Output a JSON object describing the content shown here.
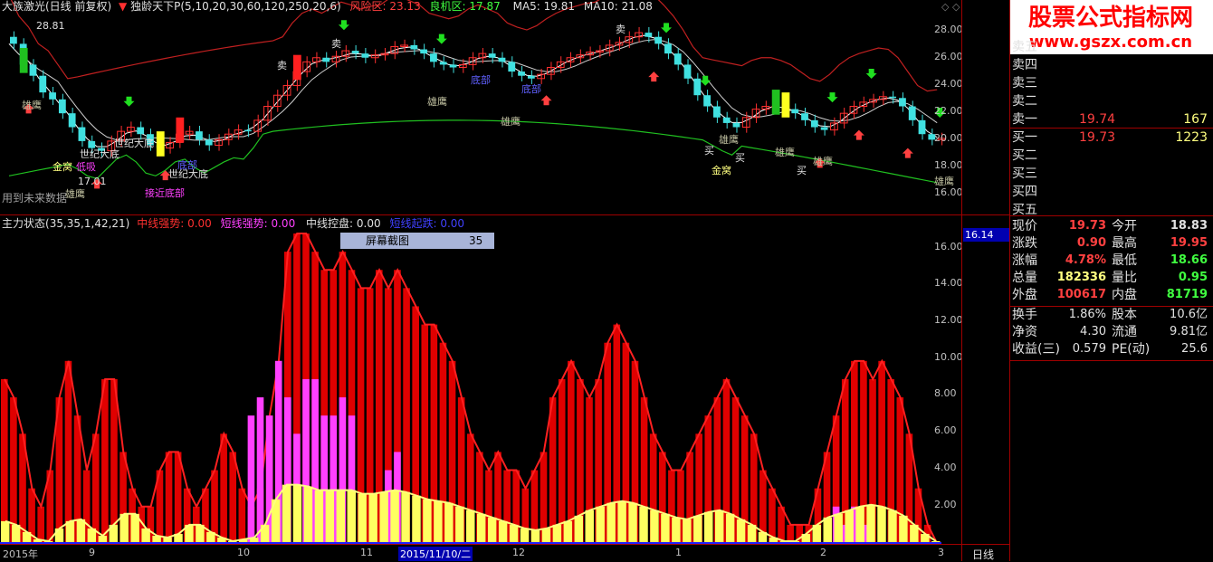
{
  "header": {
    "stock_title": "大族激光(日线 前复权)",
    "indicator_name": "独龄天下P",
    "indicator_params": "(5,10,20,30,60,120,250,20,6)",
    "risk_label": "风险区:",
    "risk_value": "23.13",
    "good_label": "良机区:",
    "good_value": "17.87",
    "ma5_label": "MA5:",
    "ma5_value": "19.81",
    "ma10_label": "MA10:",
    "ma10_value": "21.08",
    "high_marker": "28.81",
    "low_marker": "17.01",
    "future_note": "用到未来数据"
  },
  "lower_header": {
    "name": "主力状态",
    "params": "(35,35,1,42,21)",
    "mid_strong_label": "中线强势:",
    "mid_strong_value": "0.00",
    "short_strong_label": "短线强势:",
    "short_strong_value": "0.00",
    "mid_control_label": "中线控盘:",
    "mid_control_value": "0.00",
    "short_start_label": "短线起跌:",
    "short_start_value": "0.00"
  },
  "tooltip": {
    "label": "屏幕截图",
    "value": "35"
  },
  "upper_axis": [
    "28.00",
    "26.00",
    "24.00",
    "22.00",
    "20.00",
    "18.00",
    "16.00"
  ],
  "lower_axis": [
    "16.00",
    "14.00",
    "12.00",
    "10.00",
    "8.00",
    "6.00",
    "4.00",
    "2.00"
  ],
  "lower_axis_highlight": "16.14",
  "x_axis": [
    "2015年",
    "9",
    "10",
    "11",
    "2015/11/10/二",
    "12",
    "1",
    "2",
    "3"
  ],
  "period_label": "日线",
  "annotations": {
    "xiongying": "雄鹰",
    "jinchao": "金窝",
    "mai": "买",
    "maichu": "卖",
    "shiji_dadi": "世纪大底",
    "jiejinbu": "接近底部",
    "dimai": "低吸",
    "dongdi": "底部"
  },
  "watermark": {
    "title": "股票公式指标网",
    "url": "www.gszx.com.cn"
  },
  "orderbook": {
    "sell": [
      {
        "label": "卖五",
        "price": "",
        "vol": ""
      },
      {
        "label": "卖四",
        "price": "",
        "vol": ""
      },
      {
        "label": "卖三",
        "price": "",
        "vol": ""
      },
      {
        "label": "卖二",
        "price": "",
        "vol": ""
      },
      {
        "label": "卖一",
        "price": "19.74",
        "vol": "167"
      }
    ],
    "buy": [
      {
        "label": "买一",
        "price": "19.73",
        "vol": "1223"
      },
      {
        "label": "买二",
        "price": "",
        "vol": ""
      },
      {
        "label": "买三",
        "price": "",
        "vol": ""
      },
      {
        "label": "买四",
        "price": "",
        "vol": ""
      },
      {
        "label": "买五",
        "price": "",
        "vol": ""
      }
    ]
  },
  "quote": [
    {
      "l1": "现价",
      "v1": "19.73",
      "c1": "#ff4040",
      "l2": "今开",
      "v2": "18.83",
      "c2": "#e0e0e0"
    },
    {
      "l1": "涨跌",
      "v1": "0.90",
      "c1": "#ff4040",
      "l2": "最高",
      "v2": "19.95",
      "c2": "#ff4040"
    },
    {
      "l1": "涨幅",
      "v1": "4.78%",
      "c1": "#ff4040",
      "l2": "最低",
      "v2": "18.66",
      "c2": "#40ff40"
    },
    {
      "l1": "总量",
      "v1": "182336",
      "c1": "#ffff80",
      "l2": "量比",
      "v2": "0.95",
      "c2": "#40ff40"
    },
    {
      "l1": "外盘",
      "v1": "100617",
      "c1": "#ff4040",
      "l2": "内盘",
      "v2": "81719",
      "c2": "#40ff40"
    }
  ],
  "quote2": [
    {
      "l1": "换手",
      "v1": "1.86%",
      "l2": "股本",
      "v2": "10.6亿"
    },
    {
      "l1": "净资",
      "v1": "4.30",
      "l2": "流通",
      "v2": "9.81亿"
    },
    {
      "l1": "收益(三)",
      "v1": "0.579",
      "l2": "PE(动)",
      "v2": "25.6"
    }
  ],
  "chart_data": {
    "type": "bar",
    "title": "主力状态",
    "ylim": [
      0,
      17
    ],
    "red_series": [
      9,
      8,
      6,
      3,
      2,
      4,
      8,
      10,
      7,
      4,
      6,
      9,
      9,
      5,
      3,
      2,
      2,
      4,
      5,
      5,
      3,
      2,
      3,
      4,
      6,
      5,
      3,
      2,
      3,
      7,
      10,
      16,
      17,
      17,
      16,
      15,
      15,
      16,
      15,
      14,
      14,
      15,
      14,
      15,
      14,
      13,
      12,
      12,
      11,
      10,
      8,
      6,
      5,
      4,
      5,
      4,
      4,
      3,
      4,
      5,
      8,
      9,
      10,
      9,
      8,
      9,
      11,
      12,
      11,
      10,
      8,
      6,
      5,
      4,
      4,
      5,
      6,
      7,
      8,
      9,
      8,
      7,
      6,
      4,
      3,
      2,
      1,
      1,
      1,
      3,
      5,
      7,
      9,
      10,
      10,
      9,
      10,
      9,
      8,
      6,
      3,
      1,
      0
    ],
    "yellow_series": [
      1.2,
      1,
      0.6,
      0.2,
      0.1,
      0.8,
      1.2,
      1.3,
      0.8,
      0.4,
      1,
      1.6,
      1.6,
      0.8,
      0.4,
      0.3,
      0.5,
      1,
      1,
      0.6,
      0.3,
      0.1,
      0.2,
      0.3,
      1,
      2.4,
      3.2,
      3.2,
      3.1,
      2.9,
      2.9,
      2.9,
      2.9,
      2.7,
      2.7,
      2.8,
      2.9,
      2.8,
      2.6,
      2.4,
      2.3,
      2.2,
      2,
      1.8,
      1.6,
      1.4,
      1.2,
      1,
      0.8,
      0.7,
      0.8,
      1,
      1.2,
      1.5,
      1.8,
      2,
      2.2,
      2.3,
      2.2,
      2,
      1.8,
      1.6,
      1.4,
      1.3,
      1.5,
      1.7,
      1.8,
      1.6,
      1.3,
      1,
      0.6,
      0.3,
      0.1,
      0.1,
      0.5,
      1,
      1.4,
      1.6,
      1.8,
      2,
      2.1,
      2,
      1.8,
      1.5,
      1,
      0.5,
      0.1
    ],
    "magenta_series": [
      0,
      0,
      0,
      0,
      0,
      0,
      0,
      0,
      0,
      0,
      0,
      0,
      0,
      0,
      0,
      0,
      0,
      0,
      0,
      0,
      0,
      0,
      0,
      0,
      0,
      0,
      0,
      7,
      8,
      7,
      10,
      8,
      6,
      9,
      9,
      7,
      7,
      8,
      7,
      0,
      0,
      0,
      4,
      5,
      0,
      0,
      0,
      0,
      0,
      0,
      0,
      0,
      0,
      0,
      0,
      0,
      0,
      0,
      0,
      0,
      0,
      0,
      0,
      0,
      0,
      0,
      0,
      0,
      0,
      0,
      0,
      0,
      0,
      0,
      0,
      0,
      0,
      0,
      0,
      0,
      0,
      0,
      0,
      0,
      0,
      0,
      0,
      0,
      0,
      0,
      0,
      2,
      1,
      2,
      1,
      0,
      0
    ]
  }
}
